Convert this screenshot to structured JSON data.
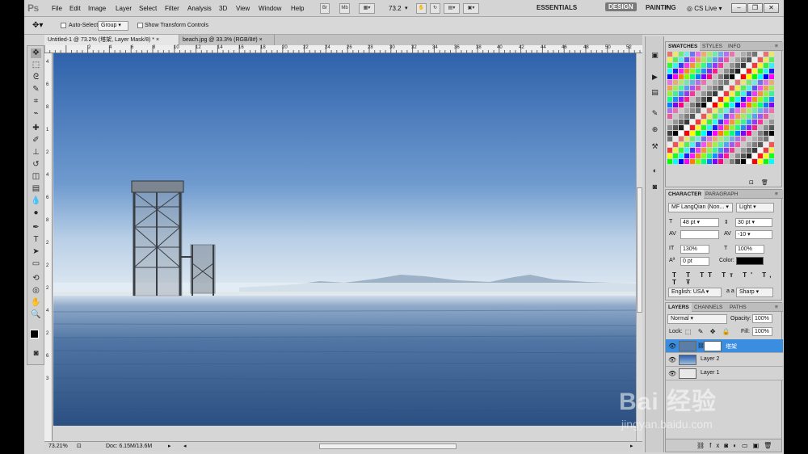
{
  "app": {
    "logo": "Ps"
  },
  "menu": [
    "File",
    "Edit",
    "Image",
    "Layer",
    "Select",
    "Filter",
    "Analysis",
    "3D",
    "View",
    "Window",
    "Help"
  ],
  "menubar": {
    "br_label": "Br",
    "mb_label": "Mb",
    "zoom": "73.2",
    "workspaces": [
      "ESSENTIALS",
      "DESIGN",
      "PAINTING"
    ],
    "workspace_more": "»",
    "cs_live": "CS Live"
  },
  "options": {
    "auto_select_label": "Auto-Select:",
    "auto_select_value": "Group",
    "transform_label": "Show Transform Controls"
  },
  "tabs": [
    {
      "label": "Untitled-1 @ 73.2% (塔架, Layer Mask/8) *",
      "close": "×"
    },
    {
      "label": "beach.jpg @ 33.3% (RGB/8#)",
      "close": "×"
    }
  ],
  "ruler": [
    "2",
    "4",
    "6",
    "8",
    "10",
    "12",
    "14",
    "16",
    "18",
    "20",
    "22",
    "24",
    "26",
    "28",
    "30",
    "32",
    "34",
    "36",
    "38",
    "40",
    "42",
    "44",
    "46",
    "48",
    "50",
    "52"
  ],
  "ruler_v": [
    "4",
    "6",
    "8",
    "1",
    "2",
    "4",
    "6",
    "8",
    "2",
    "2",
    "2",
    "4",
    "2",
    "6",
    "3"
  ],
  "status": {
    "zoom": "73.21%",
    "doc": "Doc: 6.15M/13.6M"
  },
  "swatches_panel": {
    "tabs": [
      "SWATCHES",
      "STYLES",
      "INFO"
    ]
  },
  "character_panel": {
    "tabs": [
      "CHARACTER",
      "PARAGRAPH"
    ],
    "font_family": "MF LangQian (Non...",
    "font_style": "Light",
    "font_size": "48 pt",
    "leading": "30 pt",
    "kerning": "",
    "tracking": "-10",
    "vscale": "130%",
    "hscale": "100%",
    "baseline": "0 pt",
    "color_label": "Color:",
    "language": "English: USA",
    "aa_label": "a a",
    "antialias": "Sharp"
  },
  "layers_panel": {
    "tabs": [
      "LAYERS",
      "CHANNELS",
      "PATHS"
    ],
    "blend_mode": "Normal",
    "opacity_label": "Opacity:",
    "opacity": "100%",
    "lock_label": "Lock:",
    "fill_label": "Fill:",
    "fill": "100%",
    "layers": [
      {
        "name": "塔架",
        "selected": true
      },
      {
        "name": "Layer 2",
        "selected": false
      },
      {
        "name": "Layer 1",
        "selected": false
      }
    ]
  },
  "watermark": {
    "brand": "Bai 经验",
    "url": "jingyan.baidu.com"
  },
  "colors": {
    "accent": "#3b8de0",
    "selected_layer": "#3b8de0",
    "sky_top": "#3567ae",
    "sea": "#3a5f91"
  }
}
